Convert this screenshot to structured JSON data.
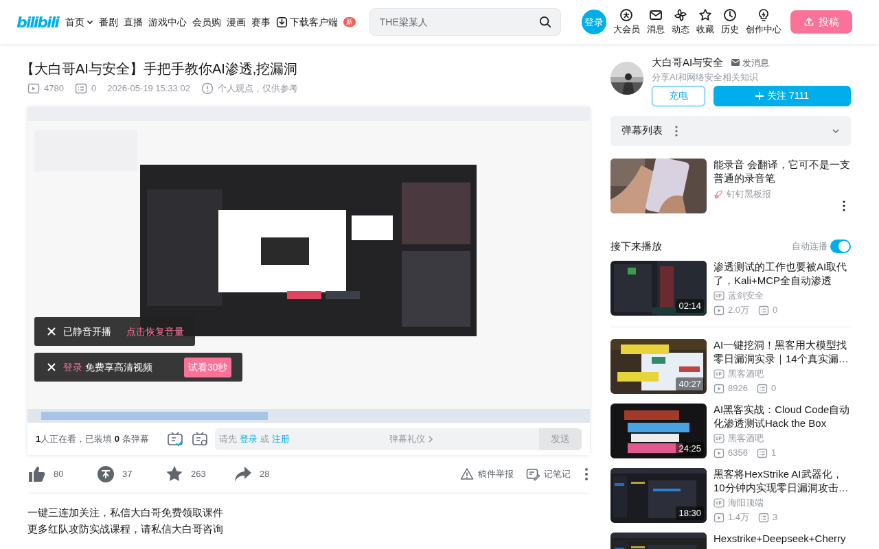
{
  "header": {
    "logo": "bilibili",
    "nav": [
      {
        "label": "首页",
        "kind": "dropdown"
      },
      {
        "label": "番剧",
        "kind": "link"
      },
      {
        "label": "直播",
        "kind": "link"
      },
      {
        "label": "游戏中心",
        "kind": "link"
      },
      {
        "label": "会员购",
        "kind": "link"
      },
      {
        "label": "漫画",
        "kind": "link"
      },
      {
        "label": "赛事",
        "kind": "link"
      },
      {
        "label": "下载客户端",
        "kind": "download",
        "badge": "新"
      }
    ],
    "search": {
      "placeholder": "THE梁某人"
    },
    "login": "登录",
    "shortcuts": [
      {
        "label": "大会员"
      },
      {
        "label": "消息"
      },
      {
        "label": "动态"
      },
      {
        "label": "收藏"
      },
      {
        "label": "历史"
      },
      {
        "label": "创作中心"
      }
    ],
    "upload": "投稿"
  },
  "video": {
    "title": "【大白哥AI与安全】手把手教你AI渗透,挖漏洞",
    "views": "4780",
    "danmaku": "0",
    "date": "2026-05-19 15:33:02",
    "notice": "个人观点，仅供参考"
  },
  "player": {
    "toasts": [
      {
        "kind": "muted",
        "text": "已静音开播",
        "action": "点击恢复音量"
      },
      {
        "kind": "login",
        "link": "登录",
        "text": "免费享高清视频",
        "button": "试看30秒"
      }
    ],
    "status": "**1**人正在看，已装填 **0** 条弹幕",
    "danmaku_input": {
      "prefix": "请先",
      "login": "登录",
      "or": "或",
      "register": "注册",
      "etiquette": "弹幕礼仪",
      "send": "发送",
      "disabled": true
    }
  },
  "actions": [
    {
      "kind": "like",
      "count": "80"
    },
    {
      "kind": "coin",
      "count": "37"
    },
    {
      "kind": "favorite",
      "count": "263"
    },
    {
      "kind": "share",
      "count": "28"
    }
  ],
  "tools": [
    {
      "kind": "report",
      "label": "稿件举报"
    },
    {
      "kind": "note",
      "label": "记笔记"
    }
  ],
  "description": [
    "一键三连加关注，私信大白哥免费领取课件",
    "更多红队攻防实战课程，请私信大白哥咨询"
  ],
  "uploader": {
    "name": "大白哥AI与安全",
    "message": "发消息",
    "bio": "分享AI和网络安全相关知识",
    "charge": "充电",
    "follow": "关注 7111"
  },
  "danmaku_list": {
    "title": "弹幕列表"
  },
  "ad": {
    "title": "能录音 会翻译，它可不是一支普通的录音笔",
    "source": "钉钉黑板报"
  },
  "next_up": {
    "title": "接下来播放",
    "autoplay": {
      "label": "自动连播",
      "on": true
    }
  },
  "recommendations": [
    {
      "title": "渗透测试的工作也要被AI取代了，Kali+MCP全自动渗透",
      "duration": "02:14",
      "author": "蓝剑安全",
      "views": "2.0万",
      "danmaku": "0"
    },
    {
      "title": "AI一键挖洞！黑客用大模型找零日漏洞实录｜14个真实漏…",
      "duration": "40:27",
      "author": "黑客酒吧",
      "views": "8926",
      "danmaku": "0"
    },
    {
      "title": "AI黑客实战：Cloud Code自动化渗透测试Hack the Box",
      "duration": "24:25",
      "author": "黑客酒吧",
      "views": "6356",
      "danmaku": "1"
    },
    {
      "title": "黑客将HexStrike AI武器化，10分钟内实现零日漏洞攻击…",
      "duration": "18:30",
      "author": "海阳顶端",
      "views": "1.4万",
      "danmaku": "3"
    },
    {
      "title": "Hexstrike+Deepseek+Cherry"
    }
  ]
}
